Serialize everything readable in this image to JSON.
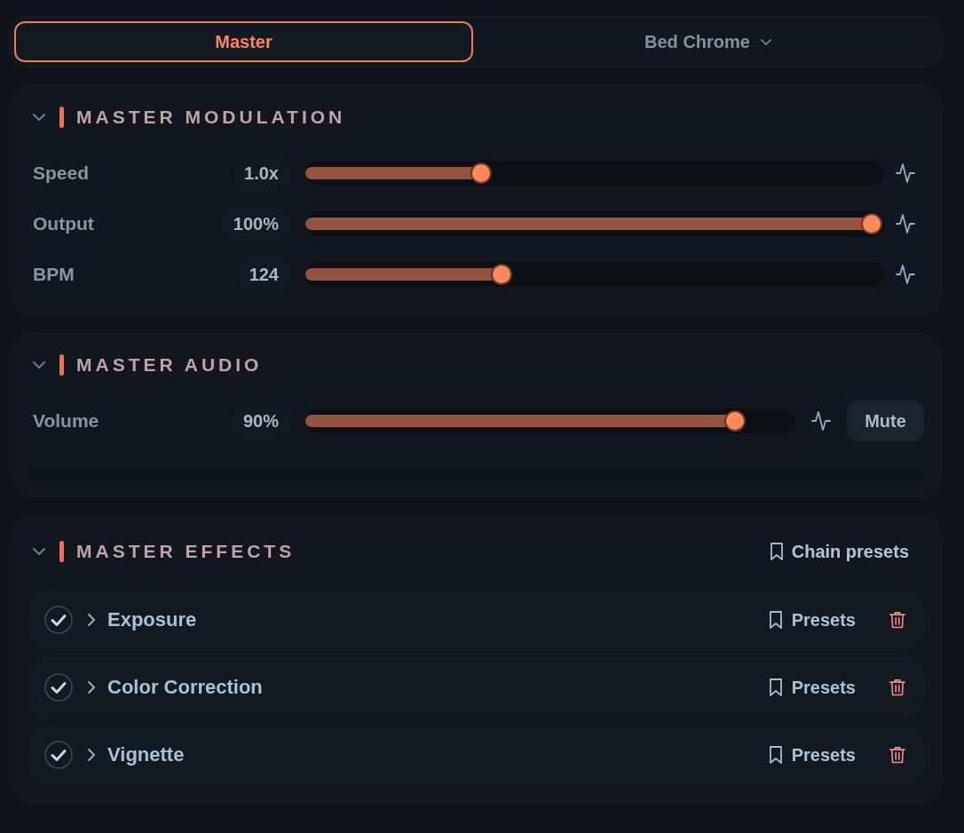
{
  "tabs": [
    {
      "label": "Master",
      "selected": true,
      "dropdown": false
    },
    {
      "label": "Bed Chrome",
      "selected": false,
      "dropdown": true
    }
  ],
  "sections": [
    {
      "kind": "sliders",
      "title": "MASTER MODULATION",
      "expanded": true,
      "rows": [
        {
          "label": "Speed",
          "value": "1.0x",
          "level": 0.31
        },
        {
          "label": "Output",
          "value": "100%",
          "level": 1.0
        },
        {
          "label": "BPM",
          "value": "124",
          "level": 0.347
        }
      ]
    },
    {
      "kind": "audio",
      "title": "MASTER AUDIO",
      "expanded": true,
      "rows": [
        {
          "label": "Volume",
          "value": "90%",
          "level": 0.9
        }
      ],
      "mute_button": "Mute"
    },
    {
      "kind": "effects",
      "title": "MASTER EFFECTS",
      "expanded": true,
      "presets_button": "Chain presets",
      "effects": [
        {
          "name": "Exposure",
          "enabled": true,
          "expanded": false,
          "presets_button": "Presets"
        },
        {
          "name": "Color Correction",
          "enabled": true,
          "expanded": false,
          "presets_button": "Presets"
        },
        {
          "name": "Vignette",
          "enabled": true,
          "expanded": false,
          "presets_button": "Presets"
        }
      ]
    }
  ]
}
